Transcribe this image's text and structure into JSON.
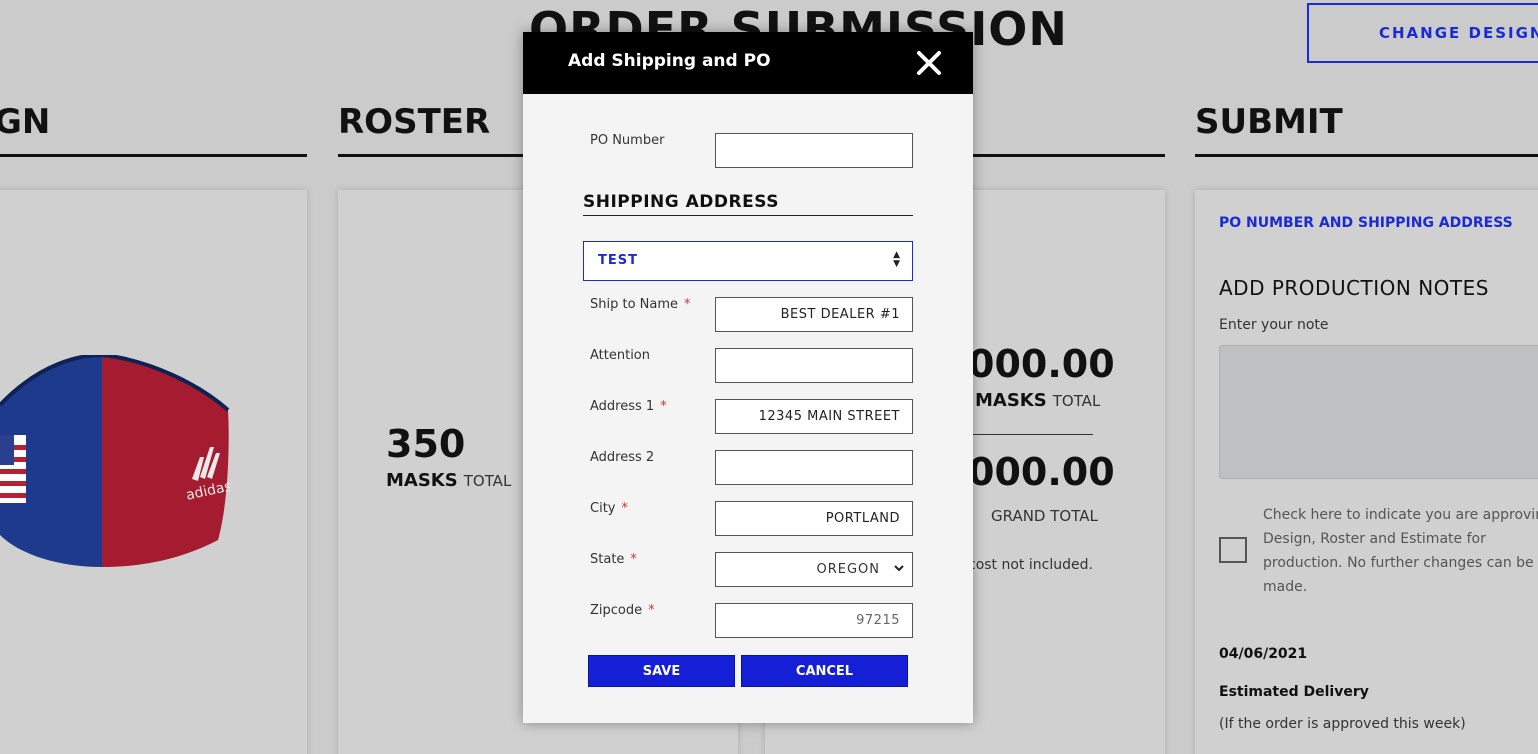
{
  "page": {
    "title": "ORDER SUBMISSION",
    "change_design": "CHANGE DESIGN"
  },
  "sections": {
    "design_partial": "GN",
    "roster": "ROSTER",
    "submit": "SUBMIT"
  },
  "roster_card": {
    "count": "350",
    "unit": "MASKS",
    "suffix": "TOTAL"
  },
  "estimate_card": {
    "amount_1": "000.00",
    "unit": "MASKS",
    "suffix": "TOTAL",
    "amount_2": "000.00",
    "grand_total": "GRAND TOTAL",
    "note": "cost not included."
  },
  "submit_card": {
    "link": "PO NUMBER AND SHIPPING ADDRESS",
    "notes_heading": "ADD PRODUCTION NOTES",
    "notes_label": "Enter your note",
    "approve_text": "Check here to indicate you are approving Design, Roster and Estimate for production. No further changes can be made.",
    "date": "04/06/2021",
    "estimated_delivery": "Estimated Delivery",
    "delivery_note": "(If the order is approved this week)"
  },
  "modal": {
    "title": "Add Shipping and PO",
    "po_label": "PO Number",
    "po_value": "",
    "shipping_heading": "SHIPPING ADDRESS",
    "address_select": "TEST",
    "fields": {
      "ship_to_name": {
        "label": "Ship to Name",
        "value": "BEST DEALER #1",
        "required": "*"
      },
      "attention": {
        "label": "Attention",
        "value": ""
      },
      "address1": {
        "label": "Address 1",
        "value": "12345 MAIN STREET",
        "required": "*"
      },
      "address2": {
        "label": "Address 2",
        "value": ""
      },
      "city": {
        "label": "City",
        "value": "PORTLAND",
        "required": "*"
      },
      "state": {
        "label": "State",
        "value": "OREGON",
        "required": "*"
      },
      "zipcode": {
        "label": "Zipcode",
        "placeholder": "97215",
        "required": "*"
      }
    },
    "save": "SAVE",
    "cancel": "CANCEL"
  },
  "icons": {
    "close": "close-icon",
    "chevron": "chevron-down-icon",
    "sort": "sort-arrows-icon",
    "mask": "face-mask-image"
  },
  "colors": {
    "accent": "#1520d6",
    "required": "#dd3333",
    "header": "#000000"
  }
}
